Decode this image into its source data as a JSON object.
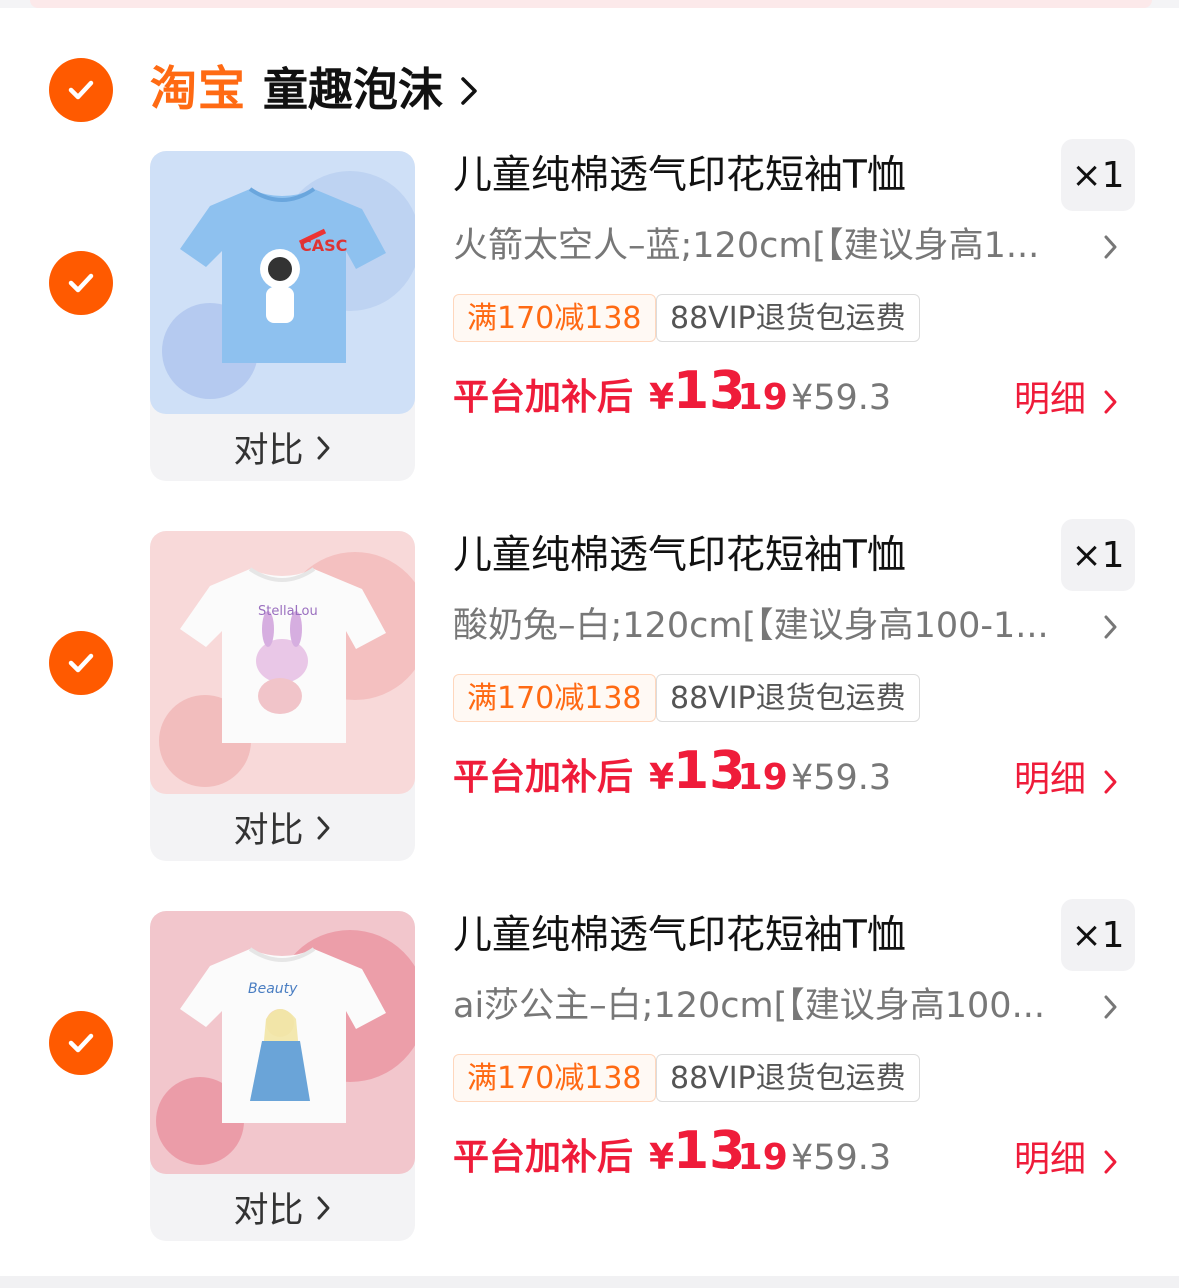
{
  "store": {
    "logo": "淘宝",
    "name": "童趣泡沫",
    "icons": {
      "check": "checkmark-icon",
      "chevron": "chevron-right-icon"
    }
  },
  "colors": {
    "accent_orange": "#ff5a00",
    "price_red": "#ef1c3a",
    "promo_orange": "#ff6a13"
  },
  "items": [
    {
      "title": "儿童纯棉透气印花短袖T恤",
      "quantity": "×1",
      "sku": "火箭太空人–蓝;120cm[【建议身高1...",
      "tags": [
        "满170减138",
        "88VIP退货包运费"
      ],
      "price_label": "平台加补后",
      "price_currency": "¥",
      "price_integer": "13",
      "price_decimal": ".19",
      "original_price": "¥59.3",
      "detail_label": "明细",
      "compare_label": "对比",
      "image": "blue astronaut t-shirt"
    },
    {
      "title": "儿童纯棉透气印花短袖T恤",
      "quantity": "×1",
      "sku": "酸奶兔–白;120cm[【建议身高100-1...",
      "tags": [
        "满170减138",
        "88VIP退货包运费"
      ],
      "price_label": "平台加补后",
      "price_currency": "¥",
      "price_integer": "13",
      "price_decimal": ".19",
      "original_price": "¥59.3",
      "detail_label": "明细",
      "compare_label": "对比",
      "image": "white bunny t-shirt"
    },
    {
      "title": "儿童纯棉透气印花短袖T恤",
      "quantity": "×1",
      "sku": "ai莎公主–白;120cm[【建议身高100...",
      "tags": [
        "满170减138",
        "88VIP退货包运费"
      ],
      "price_label": "平台加补后",
      "price_currency": "¥",
      "price_integer": "13",
      "price_decimal": ".19",
      "original_price": "¥59.3",
      "detail_label": "明细",
      "compare_label": "对比",
      "image": "white princess t-shirt"
    }
  ]
}
